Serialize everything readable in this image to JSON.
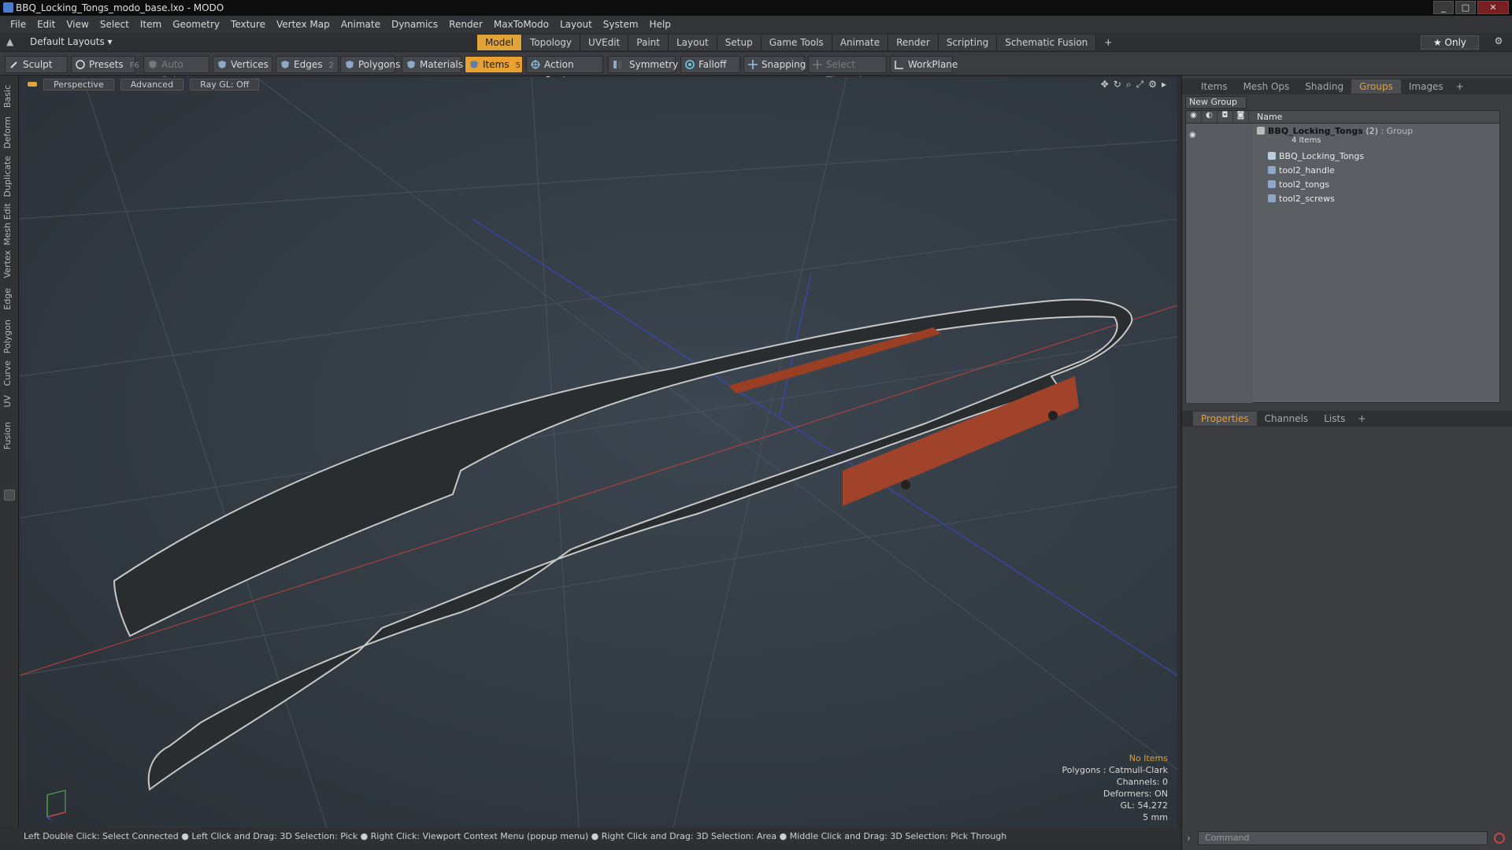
{
  "window": {
    "title": "BBQ_Locking_Tongs_modo_base.lxo - MODO",
    "controls": [
      "_",
      "□",
      "✕"
    ]
  },
  "menu": [
    "File",
    "Edit",
    "View",
    "Select",
    "Item",
    "Geometry",
    "Texture",
    "Vertex Map",
    "Animate",
    "Dynamics",
    "Render",
    "MaxToModo",
    "Layout",
    "System",
    "Help"
  ],
  "modebar": {
    "layout": "Default Layouts ▾",
    "tabs": [
      "Model",
      "Topology",
      "UVEdit",
      "Paint",
      "Layout",
      "Setup",
      "Game Tools",
      "Animate",
      "Render",
      "Scripting",
      "Schematic Fusion"
    ],
    "active": "Model",
    "plus": "+",
    "only": "★ Only",
    "gear": "⚙"
  },
  "toolbar": {
    "sculpt": "Sculpt",
    "presets": "Presets",
    "presets_key": "F6",
    "auto_select": "Auto Select",
    "vertices": "Vertices",
    "vertices_num": "1",
    "edges": "Edges",
    "edges_num": "2",
    "polygons": "Polygons",
    "materials": "Materials",
    "items": "Items",
    "items_num": "5",
    "action_center": "Action Center",
    "symmetry": "Symmetry",
    "falloff": "Falloff",
    "snapping": "Snapping",
    "select_through": "Select Through",
    "workplane": "WorkPlane"
  },
  "lefttabs": [
    "Basic",
    "Deform",
    "Duplicate",
    "Mesh Edit",
    "Vertex",
    "Edge",
    "Polygon",
    "Curve",
    "UV",
    "Fusion"
  ],
  "viewport": {
    "perspective": "Perspective",
    "advanced": "Advanced",
    "raygl": "Ray GL: Off",
    "info": {
      "no_items": "No Items",
      "polygons": "Polygons : Catmull-Clark",
      "channels": "Channels: 0",
      "deformers": "Deformers: ON",
      "gl": "GL: 54,272",
      "scale": "5 mm"
    }
  },
  "statusbar": "Left Double Click: Select Connected ● Left Click and Drag: 3D Selection: Pick ● Right Click: Viewport Context Menu (popup menu) ● Right Click and Drag: 3D Selection: Area ● Middle Click and Drag: 3D Selection: Pick Through",
  "right_top_tabs": [
    "Items",
    "Mesh Ops",
    "Shading",
    "Groups",
    "Images"
  ],
  "right_top_active": "Groups",
  "groups": {
    "new_group": "New Group",
    "name_header": "Name",
    "group_name": "BBQ_Locking_Tongs",
    "group_count": "(2)",
    "group_type": ": Group",
    "group_items": "4 Items",
    "children": [
      "BBQ_Locking_Tongs",
      "tool2_handle",
      "tool2_tongs",
      "tool2_screws"
    ]
  },
  "right_bottom_tabs": [
    "Properties",
    "Channels",
    "Lists"
  ],
  "right_bottom_active": "Properties",
  "command_placeholder": "Command",
  "colors": {
    "accent": "#e0a43a",
    "metal": "#d8d8d8",
    "wood": "#a0432a"
  }
}
